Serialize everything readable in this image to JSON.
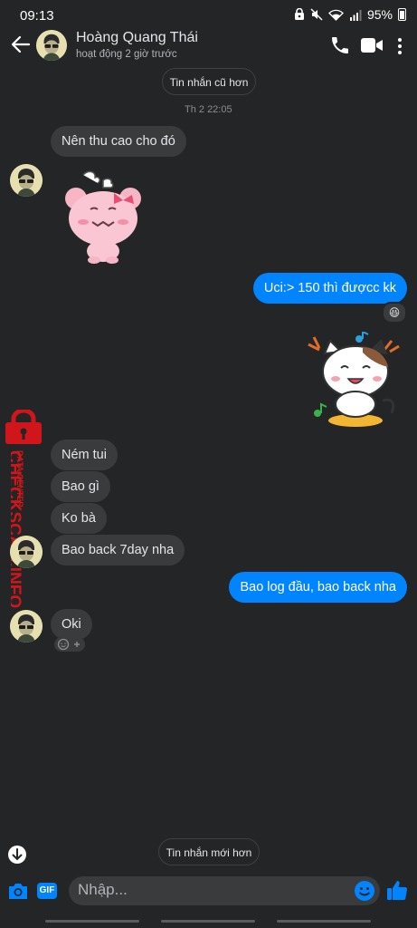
{
  "status_bar": {
    "time": "09:13",
    "battery": "95%",
    "icons": [
      "vpn-icon",
      "mute-icon",
      "wifi-icon",
      "signal-icon",
      "battery-icon"
    ]
  },
  "header": {
    "name": "Hoàng Quang Thái",
    "status": "hoạt động 2 giờ trước",
    "icons": [
      "back-arrow-icon",
      "phone-icon",
      "video-camera-icon",
      "more-vertical-icon"
    ]
  },
  "chat": {
    "older_button": "Tin nhắn cũ hơn",
    "newer_button": "Tin nhắn mới hơn",
    "timestamp": "Th 2 22:05",
    "messages": [
      {
        "side": "in",
        "text": "Nên thu cao cho đó"
      },
      {
        "side": "in",
        "type": "sticker",
        "sticker": "pink-bear-sticker"
      },
      {
        "side": "out",
        "text": "Uci:> 150 thì đượcc kk",
        "reaction": "😆"
      },
      {
        "side": "out",
        "type": "sticker",
        "sticker": "happy-cat-sticker"
      },
      {
        "side": "in",
        "text": "Ném tui"
      },
      {
        "side": "in",
        "text": "Bao gì"
      },
      {
        "side": "in",
        "text": "Ko bà"
      },
      {
        "side": "in",
        "text": "Bao back 7day nha"
      },
      {
        "side": "out",
        "text": "Bao log đầu, bao back nha"
      },
      {
        "side": "in",
        "text": "Oki"
      }
    ]
  },
  "watermark": {
    "top_text": "DATA CENTER",
    "main_text": "CHECKSCAM.INFO"
  },
  "composer": {
    "placeholder": "Nhập...",
    "gif_label": "GIF"
  },
  "colors": {
    "background": "#242526",
    "incoming_bubble": "#3a3b3c",
    "outgoing_bubble": "#0084ff",
    "accent": "#0084ff",
    "watermark": "#d0161b"
  }
}
